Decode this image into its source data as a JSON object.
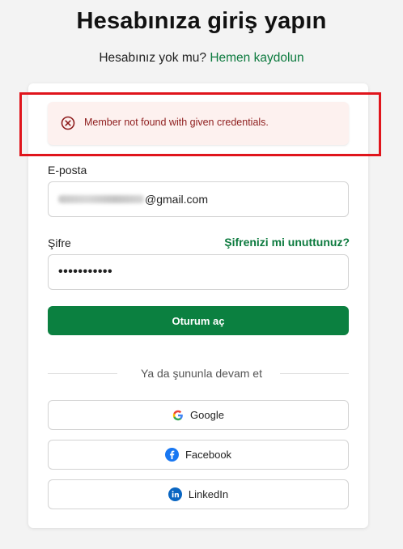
{
  "header": {
    "title": "Hesabınıza giriş yapın",
    "subtitle_prefix": "Hesabınız yok mu?",
    "signup_link": "Hemen kaydolun"
  },
  "alert": {
    "icon": "x-circle-icon",
    "message": "Member not found with given credentials.",
    "color": "#8e1d1d"
  },
  "form": {
    "email_label": "E-posta",
    "email_visible_suffix": "@gmail.com",
    "password_label": "Şifre",
    "forgot_link": "Şifrenizi mi unuttunuz?",
    "password_masked": "•••••••••••",
    "submit_label": "Oturum aç"
  },
  "divider": {
    "text": "Ya da şununla devam et"
  },
  "social": {
    "google_label": "Google",
    "facebook_label": "Facebook",
    "linkedin_label": "LinkedIn"
  },
  "colors": {
    "brand_green": "#0b8040",
    "link_green": "#0c7a3e",
    "highlight_red": "#e0151c",
    "alert_bg": "#fdf1ef"
  }
}
